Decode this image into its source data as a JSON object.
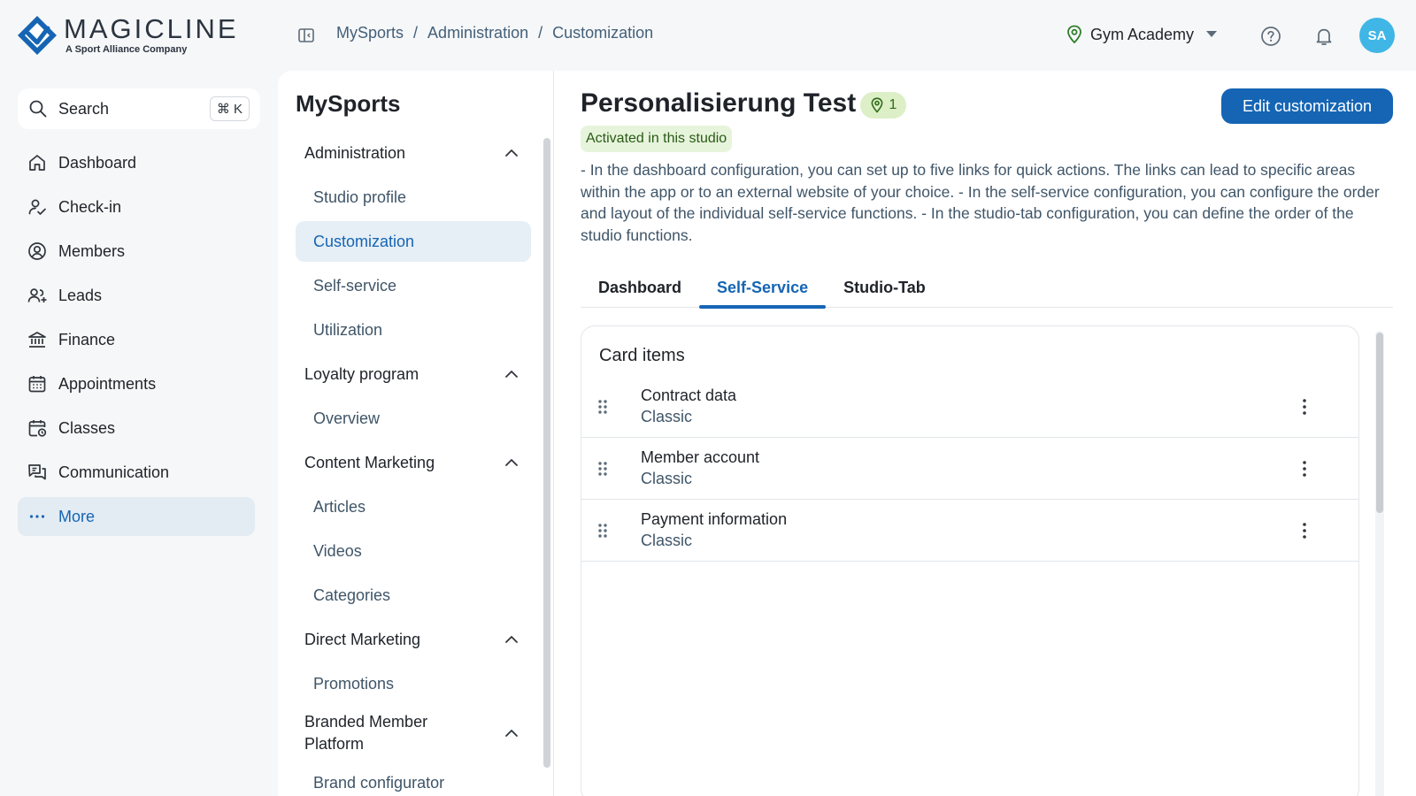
{
  "brand": {
    "name": "MAGICLINE",
    "tagline": "A Sport Alliance Company",
    "color": "#1565b4"
  },
  "header": {
    "breadcrumb": [
      "MySports",
      "Administration",
      "Customization"
    ],
    "studio": "Gym Academy",
    "avatar_initials": "SA",
    "icons": [
      "panel-toggle-icon",
      "location-pin-icon",
      "help-icon",
      "bell-icon"
    ]
  },
  "sidebar": {
    "search_label": "Search",
    "search_shortcut": "⌘ K",
    "items": [
      {
        "label": "Dashboard",
        "icon": "home-icon"
      },
      {
        "label": "Check-in",
        "icon": "check-in-icon"
      },
      {
        "label": "Members",
        "icon": "member-icon"
      },
      {
        "label": "Leads",
        "icon": "leads-icon"
      },
      {
        "label": "Finance",
        "icon": "bank-icon"
      },
      {
        "label": "Appointments",
        "icon": "calendar-icon"
      },
      {
        "label": "Classes",
        "icon": "class-calendar-icon"
      },
      {
        "label": "Communication",
        "icon": "chat-icon"
      },
      {
        "label": "More",
        "icon": "more-icon",
        "active": true
      }
    ]
  },
  "midpanel": {
    "title": "MySports",
    "groups": [
      {
        "label": "Administration",
        "items": [
          "Studio profile",
          "Customization",
          "Self-service",
          "Utilization"
        ],
        "active_item": "Customization"
      },
      {
        "label": "Loyalty program",
        "items": [
          "Overview"
        ]
      },
      {
        "label": "Content Marketing",
        "items": [
          "Articles",
          "Videos",
          "Categories"
        ]
      },
      {
        "label": "Direct Marketing",
        "items": [
          "Promotions"
        ]
      },
      {
        "label": "Branded Member Platform",
        "items": [
          "Brand configurator"
        ]
      }
    ]
  },
  "main": {
    "title": "Personalisierung Test",
    "location_count": "1",
    "status": "Activated in this studio",
    "edit_button": "Edit customization",
    "description": "- In the dashboard configuration, you can set up to five links for quick actions. The links can lead to specific areas within the app or to an external website of your choice. - In the self-service configuration, you can configure the order and layout of the individual self-service functions. - In the studio-tab configuration, you can define the order of the studio functions.",
    "tabs": [
      {
        "label": "Dashboard"
      },
      {
        "label": "Self-Service",
        "active": true
      },
      {
        "label": "Studio-Tab"
      }
    ],
    "card": {
      "title": "Card items",
      "rows": [
        {
          "title": "Contract data",
          "subtitle": "Classic"
        },
        {
          "title": "Member account",
          "subtitle": "Classic"
        },
        {
          "title": "Payment information",
          "subtitle": "Classic"
        }
      ]
    }
  }
}
